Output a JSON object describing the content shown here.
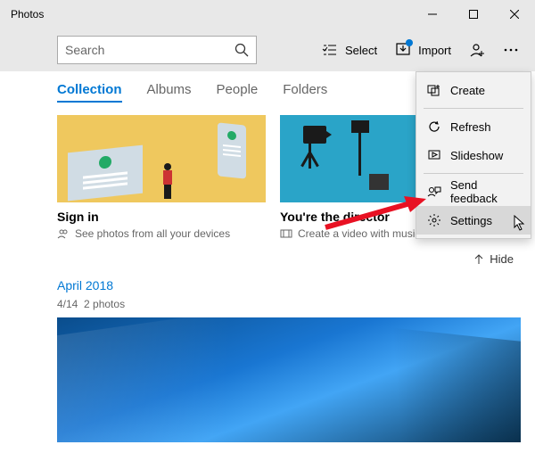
{
  "window": {
    "title": "Photos"
  },
  "toolbar": {
    "search_placeholder": "Search",
    "select": "Select",
    "import": "Import"
  },
  "tabs": {
    "collection": "Collection",
    "albums": "Albums",
    "people": "People",
    "folders": "Folders"
  },
  "cards": {
    "signin": {
      "title": "Sign in",
      "sub": "See photos from all your devices"
    },
    "director": {
      "title": "You're the director",
      "sub": "Create a video with music"
    }
  },
  "hide": "Hide",
  "section": {
    "title": "April 2018",
    "sub_date": "4/14",
    "sub_count": "2 photos"
  },
  "menu": {
    "create": "Create",
    "refresh": "Refresh",
    "slideshow": "Slideshow",
    "feedback": "Send feedback",
    "settings": "Settings"
  }
}
